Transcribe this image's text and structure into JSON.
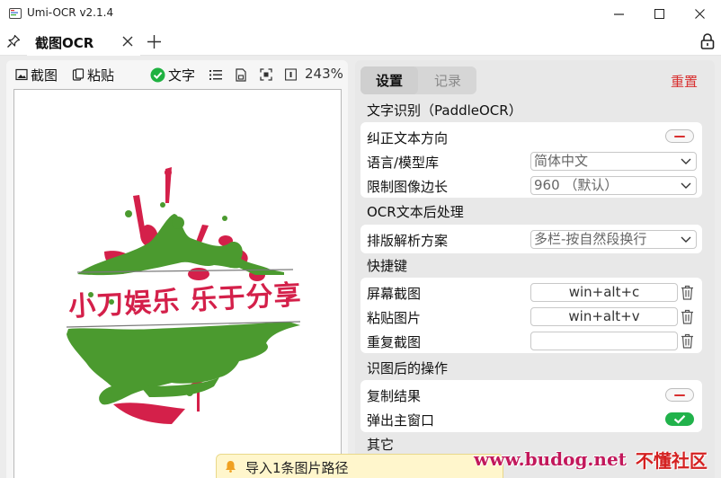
{
  "window": {
    "title": "Umi-OCR v2.1.4",
    "controls": {
      "minimize": "─",
      "maximize": "☐",
      "close": "✕"
    }
  },
  "tabs": {
    "active_label": "截图OCR",
    "close_glyph": "✕",
    "add_glyph": "+"
  },
  "left": {
    "toolbar": {
      "screenshot_label": "截图",
      "paste_label": "粘贴",
      "text_label": "文字",
      "zoom": "243%"
    },
    "image": {
      "caption": "小刀娱乐 乐于分享",
      "colors": {
        "green": "#4b9a2f",
        "red": "#d4204a"
      }
    }
  },
  "right": {
    "tabs": {
      "settings": "设置",
      "records": "记录"
    },
    "reset_label": "重置",
    "sections": {
      "ocr": {
        "title": "文字识别（PaddleOCR）",
        "rows": {
          "correct_direction": "纠正文本方向",
          "language": "语言/模型库",
          "limit_size": "限制图像边长"
        },
        "language_value": "简体中文",
        "limit_value": "960 （默认）"
      },
      "post": {
        "title": "OCR文本后处理",
        "layout_label": "排版解析方案",
        "layout_value": "多栏-按自然段换行"
      },
      "hotkeys": {
        "title": "快捷键",
        "items": [
          {
            "label": "屏幕截图",
            "value": "win+alt+c"
          },
          {
            "label": "粘贴图片",
            "value": "win+alt+v"
          },
          {
            "label": "重复截图",
            "value": ""
          }
        ]
      },
      "after": {
        "title": "识图后的操作",
        "copy_label": "复制结果",
        "popup_label": "弹出主窗口"
      },
      "other": {
        "title": "其它"
      }
    }
  },
  "toast": {
    "text": "导入1条图片路径"
  },
  "watermark": {
    "url": "www.budog.net",
    "cn": "不懂社区"
  },
  "colors": {
    "accent_red": "#d83030",
    "toggle_green": "#21b24b",
    "check_green": "#1fb141",
    "toast_bg": "#fff6cc"
  }
}
